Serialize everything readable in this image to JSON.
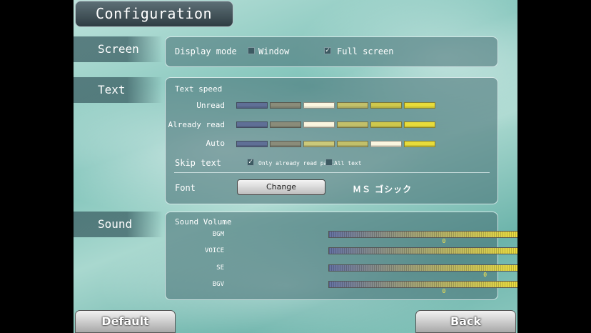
{
  "header": {
    "title": "Configuration"
  },
  "screen": {
    "tab": "Screen",
    "display_mode_label": "Display mode",
    "options": [
      {
        "label": "Window",
        "checked": false
      },
      {
        "label": "Full screen",
        "checked": true
      }
    ]
  },
  "text": {
    "tab": "Text",
    "speed_label": "Text speed",
    "rows": [
      {
        "label": "Unread",
        "selected": 3
      },
      {
        "label": "Already read",
        "selected": 3
      },
      {
        "label": "Auto",
        "selected": 5
      }
    ],
    "skip_label": "Skip text",
    "skip_options": [
      {
        "label": "Only already read part",
        "checked": true
      },
      {
        "label": "All text",
        "checked": false
      }
    ],
    "font_label": "Font",
    "change_label": "Change",
    "font_name": "ＭＳ ゴシック"
  },
  "sound": {
    "tab": "Sound",
    "volume_label": "Sound  Volume",
    "channels": [
      {
        "label": "BGM",
        "value": 0.58
      },
      {
        "label": "VOICE",
        "value": 1.0
      },
      {
        "label": "SE",
        "value": 0.79
      },
      {
        "label": "BGV",
        "value": 0.58
      }
    ]
  },
  "footer": {
    "default_label": "Default",
    "back_label": "Back"
  },
  "colors": {
    "seg_fill": [
      "#5f6f96",
      "#8a8c7a",
      "#f7f3dc",
      "#c2c06a",
      "#cfc84c",
      "#e8dc3a"
    ],
    "slider_left": "#6673a3",
    "slider_right": "#f2e23a"
  }
}
